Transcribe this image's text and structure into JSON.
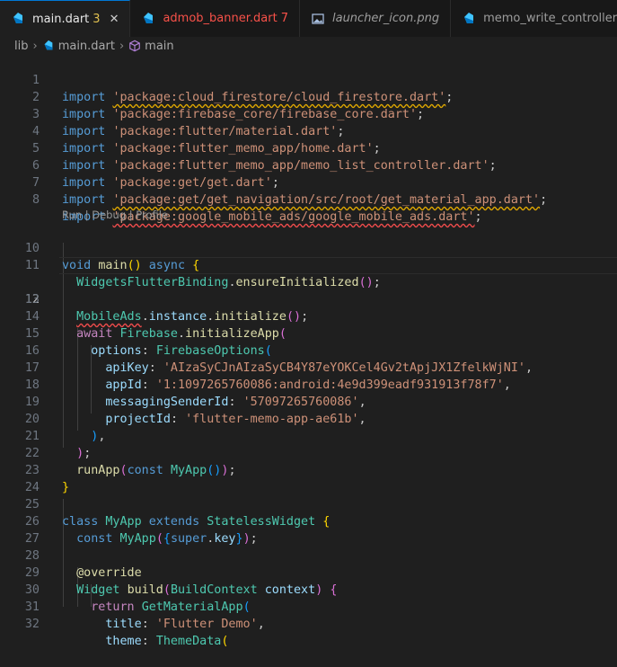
{
  "tabs": [
    {
      "label": "main.dart",
      "badge": "3",
      "active": true
    },
    {
      "label": "admob_banner.dart",
      "badge": "7",
      "active": false
    },
    {
      "label": "launcher_icon.png",
      "badge": "",
      "active": false
    },
    {
      "label": "memo_write_controller.dart",
      "badge": "",
      "active": false
    }
  ],
  "breadcrumb": {
    "folder": "lib",
    "file": "main.dart",
    "symbol": "main"
  },
  "codelens": "Run | Debug | Profile",
  "line_numbers": [
    "1",
    "2",
    "3",
    "4",
    "5",
    "6",
    "7",
    "8",
    "10",
    "11",
    "12",
    "13",
    "14",
    "15",
    "16",
    "17",
    "18",
    "19",
    "20",
    "21",
    "22",
    "23",
    "24",
    "25",
    "26",
    "27",
    "28",
    "29",
    "30",
    "31",
    "32"
  ],
  "code": {
    "import_kw": "import",
    "l1": "'package:cloud_firestore/cloud_firestore.dart'",
    "l2": "'package:firebase_core/firebase_core.dart'",
    "l3": "'package:flutter/material.dart'",
    "l4": "'package:flutter_memo_app/home.dart'",
    "l5": "'package:flutter_memo_app/memo_list_controller.dart'",
    "l6": "'package:get/get.dart'",
    "l7": "'package:get/get_navigation/src/root/get_material_app.dart'",
    "l8": "'package:google_mobile_ads/google_mobile_ads.dart'",
    "semi": ";",
    "void_kw": "void",
    "main_fn": "main",
    "async_kw": "async",
    "wfb": "WidgetsFlutterBinding",
    "ensure": "ensureInitialized",
    "mobileads": "MobileAds",
    "instance": "instance",
    "initialize": "initialize",
    "await_kw": "await",
    "firebase": "Firebase",
    "initapp": "initializeApp",
    "options": "options",
    "fbopts": "FirebaseOptions",
    "apiKey": "apiKey",
    "apiKey_val": "'AIzaSyCJnAIzaSyCB4Y87eYOKCel4Gv2tApjJX1ZfelkWjNI'",
    "appId": "appId",
    "appId_val": "'1:1097265760086:android:4e9d399eadf931913f78f7'",
    "msid": "messagingSenderId",
    "msid_val": "'57097265760086'",
    "projectId": "projectId",
    "projectId_val": "'flutter-memo-app-ae61b'",
    "runapp": "runApp",
    "const_kw": "const",
    "myapp": "MyApp",
    "class_kw": "class",
    "extends_kw": "extends",
    "stateless": "StatelessWidget",
    "super_kw": "super",
    "key": "key",
    "override": "@override",
    "widget": "Widget",
    "build": "build",
    "buildctx": "BuildContext",
    "context": "context",
    "return_kw": "return",
    "getmat": "GetMaterialApp",
    "title": "title",
    "title_val": "'Flutter Demo'",
    "theme": "theme",
    "themedata": "ThemeData"
  },
  "colors": {
    "accent": "#0078d4",
    "error": "#f14c4c",
    "warning": "#e0a800"
  }
}
